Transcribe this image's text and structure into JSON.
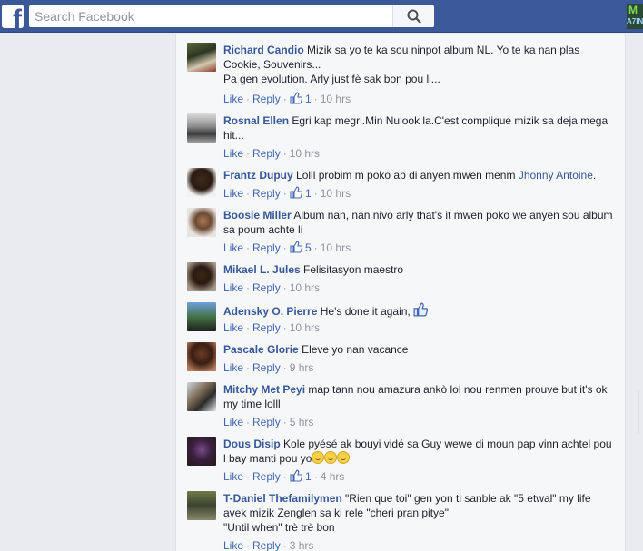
{
  "search": {
    "placeholder": "Search Facebook"
  },
  "corner_badge": {
    "top": "M",
    "bottom": "A7IN"
  },
  "actions": {
    "like": "Like",
    "reply": "Reply",
    "sep": "·"
  },
  "comments": [
    {
      "author": "Richard Candio",
      "text": "Mizik sa yo te ka sou ninpot album NL. Yo te ka nan plas Cookie, Souvenirs...",
      "line2": "Pa gen evolution. Arly just fè sak bon pou li...",
      "likes": "1",
      "time": "10 hrs"
    },
    {
      "author": "Rosnal Ellen",
      "text": "Egri kap megri.Min Nulook la.C'est complique mizik sa deja mega hit...",
      "likes": "",
      "time": "10 hrs"
    },
    {
      "author": "Frantz Dupuy",
      "text": "Lolll probim m poko ap di anyen mwen menm",
      "mention": "Jhonny Antoine",
      "after_mention": ".",
      "likes": "1",
      "time": "10 hrs"
    },
    {
      "author": "Boosie Miller",
      "text": "Album nan, nan nivo arly that's it mwen poko we anyen sou album sa poum achte li",
      "likes": "5",
      "time": "10 hrs"
    },
    {
      "author": "Mikael L. Jules",
      "text": "Felisitasyon maestro",
      "likes": "",
      "time": "10 hrs"
    },
    {
      "author": "Adensky O. Pierre",
      "text": "He's done it again,",
      "likes": "",
      "time": "10 hrs"
    },
    {
      "author": "Pascale Glorie",
      "text": "Eleve yo nan vacance",
      "likes": "",
      "time": "9 hrs"
    },
    {
      "author": "Mitchy Met Peyi",
      "text": "map tann nou amazura ankò lol nou renmen prouve but it's ok my time lolll",
      "likes": "",
      "time": "5 hrs"
    },
    {
      "author": "Dous Disip",
      "text": "Kole pyésé ak bouyi vidé sa Guy wewe di moun pap vinn achtel pou l bay manti pou yo",
      "likes": "1",
      "time": "4 hrs"
    },
    {
      "author": "T-Daniel Thefamilymen",
      "text": "\"Rien que toi\" gen yon ti sanble ak \"5 etwal\" my life avek mizik Zenglen sa ki rele \"cheri pran pitye\"",
      "line2": "\"Until when\" trè trè bon",
      "likes": "",
      "time": "3 hrs"
    }
  ],
  "colors": {
    "topbar": "#3b5998",
    "link": "#365899",
    "action": "#4267b2",
    "meta": "#90949c",
    "panel": "#f6f7f9",
    "page": "#e9ebee"
  }
}
